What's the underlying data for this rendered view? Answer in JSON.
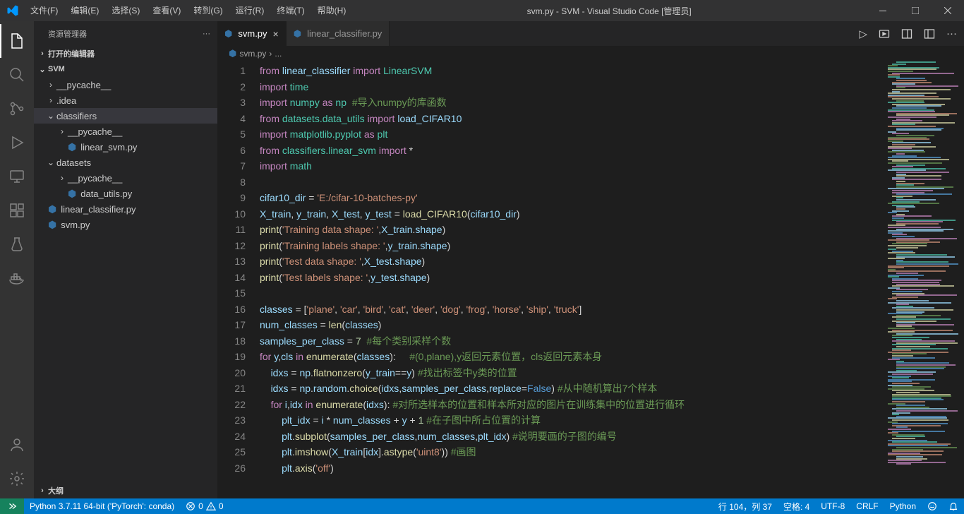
{
  "menu": [
    "文件(F)",
    "编辑(E)",
    "选择(S)",
    "查看(V)",
    "转到(G)",
    "运行(R)",
    "终端(T)",
    "帮助(H)"
  ],
  "title": "svm.py - SVM - Visual Studio Code [管理员]",
  "sidebar": {
    "header": "资源管理器",
    "sections": {
      "open_editors": "打开的编辑器",
      "project": "SVM",
      "outline": "大纲"
    }
  },
  "tree": {
    "pycache": "__pycache__",
    "idea": ".idea",
    "classifiers": "classifiers",
    "cls_py": "__pycache__",
    "linear_svm": "linear_svm.py",
    "datasets": "datasets",
    "ds_py": "__pycache__",
    "data_utils": "data_utils.py",
    "linear_classifier": "linear_classifier.py",
    "svm": "svm.py"
  },
  "tabs": {
    "active": "svm.py",
    "other": "linear_classifier.py"
  },
  "breadcrumb": {
    "file": "svm.py",
    "sep": "›",
    "more": "..."
  },
  "lines": [
    "1",
    "2",
    "3",
    "4",
    "5",
    "6",
    "7",
    "8",
    "9",
    "10",
    "11",
    "12",
    "13",
    "14",
    "15",
    "16",
    "17",
    "18",
    "19",
    "20",
    "21",
    "22",
    "23",
    "24",
    "25",
    "26"
  ],
  "status": {
    "python": "Python 3.7.11 64-bit ('PyTorch': conda)",
    "err": "0",
    "warn": "0",
    "pos": "行 104，列 37",
    "spaces": "空格: 4",
    "enc": "UTF-8",
    "eol": "CRLF",
    "lang": "Python"
  },
  "code_tokens": {
    "l1": {
      "a": "from",
      "b": "linear_classifier",
      "c": "import",
      "d": "LinearSVM"
    },
    "l2": {
      "a": "import",
      "b": "time"
    },
    "l3": {
      "a": "import",
      "b": "numpy",
      "c": "as",
      "d": "np",
      "cmt": "#导入numpy的库函数"
    },
    "l4": {
      "a": "from",
      "b": "datasets.data_utils",
      "c": "import",
      "d": "load_CIFAR10"
    },
    "l5": {
      "a": "import",
      "b": "matplotlib.pyplot",
      "c": "as",
      "d": "plt"
    },
    "l6": {
      "a": "from",
      "b": "classifiers.linear_svm",
      "c": "import",
      "d": "*"
    },
    "l7": {
      "a": "import",
      "b": "math"
    },
    "l9": {
      "a": "cifar10_dir",
      "b": "=",
      "c": "'E:/cifar-10-batches-py'"
    },
    "l10": {
      "a": "X_train",
      "b": "y_train",
      "c": "X_test",
      "d": "y_test",
      "e": "=",
      "f": "load_CIFAR10",
      "g": "cifar10_dir"
    },
    "l11": {
      "a": "print",
      "b": "'Training data shape: '",
      "c": "X_train",
      "d": "shape"
    },
    "l12": {
      "a": "print",
      "b": "'Training labels shape: '",
      "c": "y_train",
      "d": "shape"
    },
    "l13": {
      "a": "print",
      "b": "'Test data shape: '",
      "c": "X_test",
      "d": "shape"
    },
    "l14": {
      "a": "print",
      "b": "'Test labels shape: '",
      "c": "y_test",
      "d": "shape"
    },
    "l16": {
      "a": "classes",
      "b": "=",
      "c": "'plane'",
      "d": "'car'",
      "e": "'bird'",
      "f": "'cat'",
      "g": "'deer'",
      "h": "'dog'",
      "i": "'frog'",
      "j": "'horse'",
      "k": "'ship'",
      "l": "'truck'"
    },
    "l17": {
      "a": "num_classes",
      "b": "=",
      "c": "len",
      "d": "classes"
    },
    "l18": {
      "a": "samples_per_class",
      "b": "=",
      "c": "7",
      "cmt": "#每个类别采样个数"
    },
    "l19": {
      "a": "for",
      "b": "y",
      "c": "cls",
      "d": "in",
      "e": "enumerate",
      "f": "classes",
      "cmt": "#(0,plane),y返回元素位置，cls返回元素本身"
    },
    "l20": {
      "a": "idxs",
      "b": "=",
      "c": "np",
      "d": "flatnonzero",
      "e": "y_train",
      "f": "y",
      "cmt": "#找出标签中y类的位置"
    },
    "l21": {
      "a": "idxs",
      "b": "=",
      "c": "np",
      "d": "random",
      "e": "choice",
      "f": "idxs",
      "g": "samples_per_class",
      "h": "replace",
      "i": "False",
      "cmt": "#从中随机算出7个样本"
    },
    "l22": {
      "a": "for",
      "b": "i",
      "c": "idx",
      "d": "in",
      "e": "enumerate",
      "f": "idxs",
      "cmt": "#对所选样本的位置和样本所对应的图片在训练集中的位置进行循环"
    },
    "l23": {
      "a": "plt_idx",
      "b": "=",
      "c": "i",
      "d": "num_classes",
      "e": "y",
      "f": "1",
      "cmt": "#在子图中所占位置的计算"
    },
    "l24": {
      "a": "plt",
      "b": "subplot",
      "c": "samples_per_class",
      "d": "num_classes",
      "e": "plt_idx",
      "cmt": "#说明要画的子图的编号"
    },
    "l25": {
      "a": "plt",
      "b": "imshow",
      "c": "X_train",
      "d": "idx",
      "e": "astype",
      "f": "'uint8'",
      "cmt": "#画图"
    },
    "l26": {
      "a": "plt",
      "b": "axis",
      "c": "'off'"
    }
  }
}
